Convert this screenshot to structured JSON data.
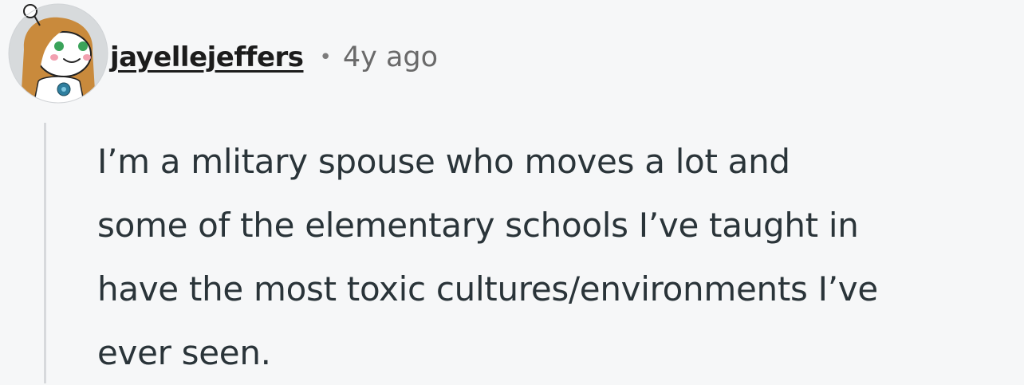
{
  "comment": {
    "author": "jayellejeffers",
    "separator": "•",
    "time_ago": "4y ago",
    "body_lines": [
      "I’m a mlitary spouse who moves a lot and",
      "some of the elementary schools I’ve taught in",
      "have the most toxic cultures/environments I’ve",
      "ever seen."
    ]
  },
  "avatar": {
    "icon": "snoo-avatar-icon",
    "background": "#d7dadc",
    "hair_color": "#c98a3c",
    "eye_color": "#3aa35a",
    "cheek_color": "#f2a0b0"
  },
  "colors": {
    "page_background": "#f6f7f8",
    "text": "#2a3439",
    "thread_line": "#d7d9dc"
  }
}
